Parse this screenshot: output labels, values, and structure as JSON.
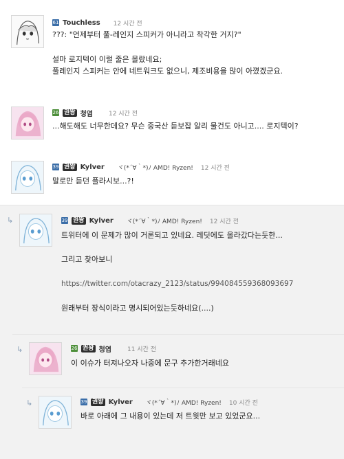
{
  "comments": [
    {
      "level": "61",
      "badge": "",
      "nick": "Touchless",
      "flair": "",
      "time": "12 시간 전",
      "lines": [
        "???: \"언제부터 풀-레인지 스피커가 아니라고 착각한 거지?\"",
        "설마 로지텍이 이럴 줄은 몰랐네요;",
        "풀레인지 스피커는 안에 네트워크도 없으니, 제조비용을 많이 아꼈겠군요."
      ]
    },
    {
      "level": "26",
      "badge": "권왕",
      "nick": "청염",
      "flair": "",
      "time": "12 시간 전",
      "lines": [
        "...해도해도 너무한데요? 무슨 중국산 듣보잡 알리 물건도 아니고.... 로지텍이?"
      ]
    },
    {
      "level": "39",
      "badge": "권왕",
      "nick": "Kylver",
      "flair": "ヾ(*´∀｀*)ﾉ  AMD! Ryzen!",
      "time": "12 시간 전",
      "lines": [
        "말로만 듣던 플라시보...?!"
      ]
    },
    {
      "level": "39",
      "badge": "권왕",
      "nick": "Kylver",
      "flair": "ヾ(*´∀｀*)ﾉ  AMD! Ryzen!",
      "time": "12 시간 전",
      "lines": [
        "트위터에 이 문제가 많이 거론되고 있네요. 레딧에도 올라갔다는듯한...",
        "그리고 찾아보니",
        "https://twitter.com/otacrazy_2123/status/994084559368093697",
        "원래부터 장식이라고 명시되어있는듯하네요(....)"
      ]
    },
    {
      "level": "26",
      "badge": "권왕",
      "nick": "청염",
      "flair": "",
      "time": "11 시간 전",
      "lines": [
        "이 이슈가 터져나오자 나중에 문구 추가한거래네요"
      ]
    },
    {
      "level": "39",
      "badge": "권왕",
      "nick": "Kylver",
      "flair": "ヾ(*´∀｀*)ﾉ  AMD! Ryzen!",
      "time": "10 시간 전",
      "lines": [
        "바로 아래에 그 내용이 있는데 저 트윗만 보고 있었군요..."
      ]
    }
  ],
  "colors": {
    "bg": "#ffffff",
    "reply_bg": "#f2f2f2",
    "badge": "#2d2d2d"
  }
}
